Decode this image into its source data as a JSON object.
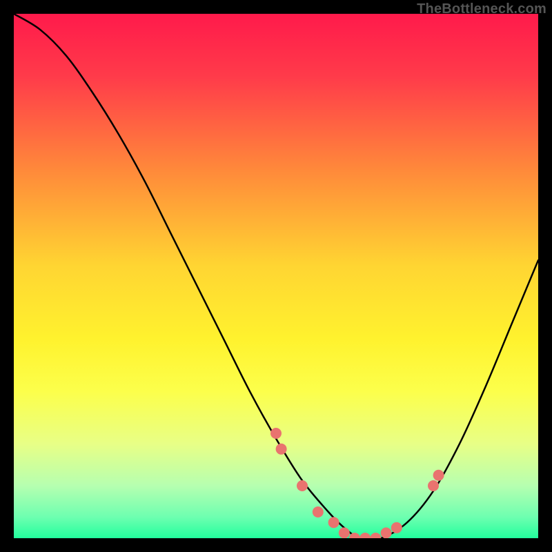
{
  "watermark": "TheBottleneck.com",
  "chart_data": {
    "type": "line",
    "title": "",
    "xlabel": "",
    "ylabel": "",
    "xlim": [
      0,
      100
    ],
    "ylim": [
      0,
      100
    ],
    "grid": false,
    "legend": false,
    "background_gradient_stops": [
      {
        "offset": 0.0,
        "color": "#ff1a4b"
      },
      {
        "offset": 0.12,
        "color": "#ff3b4a"
      },
      {
        "offset": 0.3,
        "color": "#ff8a3a"
      },
      {
        "offset": 0.48,
        "color": "#ffd532"
      },
      {
        "offset": 0.62,
        "color": "#fff22e"
      },
      {
        "offset": 0.72,
        "color": "#fcff4b"
      },
      {
        "offset": 0.82,
        "color": "#e8ff86"
      },
      {
        "offset": 0.9,
        "color": "#b6ffb0"
      },
      {
        "offset": 0.96,
        "color": "#6dffb0"
      },
      {
        "offset": 1.0,
        "color": "#22ff9d"
      }
    ],
    "series": [
      {
        "name": "bottleneck-curve",
        "color": "#000000",
        "x": [
          0,
          5,
          10,
          15,
          20,
          25,
          30,
          35,
          40,
          45,
          50,
          55,
          60,
          63,
          66,
          70,
          75,
          80,
          85,
          90,
          95,
          100
        ],
        "y": [
          100,
          97,
          92,
          85,
          77,
          68,
          58,
          48,
          38,
          28,
          19,
          11,
          5,
          2,
          0,
          0,
          3,
          9,
          18,
          29,
          41,
          53
        ]
      }
    ],
    "markers": {
      "name": "highlighted-points",
      "color": "#e9736f",
      "radius": 8,
      "x": [
        50,
        51,
        55,
        58,
        61,
        63,
        65,
        67,
        69,
        71,
        73,
        80,
        81
      ],
      "y": [
        20,
        17,
        10,
        5,
        3,
        1,
        0,
        0,
        0,
        1,
        2,
        10,
        12
      ]
    }
  }
}
